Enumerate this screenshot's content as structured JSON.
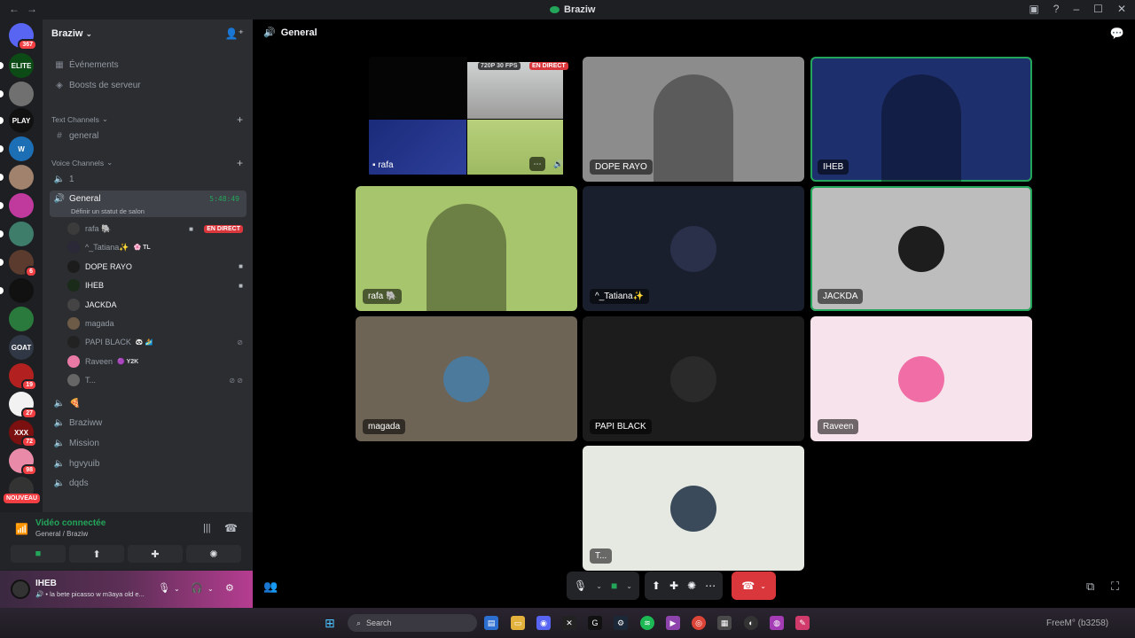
{
  "window": {
    "title": "Braziw"
  },
  "servers": [
    {
      "id": "discord-home",
      "badge": "367",
      "color": "#5865f2"
    },
    {
      "id": "elite",
      "label": "ELITE",
      "color": "#0c4a16"
    },
    {
      "id": "s3",
      "color": "#707070"
    },
    {
      "id": "s4",
      "label": "PLAY",
      "color": "#111"
    },
    {
      "id": "s5",
      "label": "W",
      "color": "#1c6fb5"
    },
    {
      "id": "s6",
      "color": "#a0826d"
    },
    {
      "id": "s7",
      "color": "#c0399d"
    },
    {
      "id": "s8",
      "color": "#3d7d6a"
    },
    {
      "id": "s9",
      "badge": "6",
      "color": "#5a3b2e"
    },
    {
      "id": "s10",
      "color": "#111"
    },
    {
      "id": "s11",
      "color": "#2a7a3d"
    },
    {
      "id": "s12",
      "label": "GOAT",
      "color": "#303845"
    },
    {
      "id": "s13",
      "badge": "19",
      "color": "#b32020"
    },
    {
      "id": "s14",
      "badge": "27",
      "color": "#f2f2f2"
    },
    {
      "id": "s15",
      "label": "XXX",
      "badge": "72",
      "color": "#7a1010"
    },
    {
      "id": "s16",
      "badge": "98",
      "color": "#e88aa8"
    },
    {
      "id": "s17",
      "color": "#333"
    }
  ],
  "server_new_badge": "NOUVEAU",
  "sidebar": {
    "guild_name": "Braziw",
    "top_links": [
      {
        "label": "Événements"
      },
      {
        "label": "Boosts de serveur"
      }
    ],
    "text_category": "Text Channels",
    "text_channels": [
      {
        "label": "general"
      }
    ],
    "voice_category": "Voice Channels",
    "voice_channel_1": "1",
    "active_channel": {
      "label": "General",
      "timer": "5:48:49",
      "status": "Définir un statut de salon"
    },
    "members": [
      {
        "name": "rafa 🐘",
        "live": "EN DIRECT",
        "av": "#3b3b3b"
      },
      {
        "name": "^_Tatiana✨",
        "tag": "🌸 TL",
        "av": "#2b2838"
      },
      {
        "name": "DOPE RAYO",
        "av": "#1c1c1c",
        "cam": true
      },
      {
        "name": "IHEB",
        "av": "#1a2b1a",
        "cam": true
      },
      {
        "name": "JACKDA",
        "av": "#444",
        "bright": true
      },
      {
        "name": "magada",
        "av": "#6d5a47"
      },
      {
        "name": "PAPI BLACK",
        "tag": "🐼 🏄",
        "av": "#222"
      },
      {
        "name": "Raveen",
        "tag": "🟣 Y2K",
        "av": "#e87aa5"
      },
      {
        "name": "T...",
        "av": "#666"
      }
    ],
    "other_voice_channels": [
      {
        "label": "🍕"
      },
      {
        "label": "Braziww"
      },
      {
        "label": "Mission"
      },
      {
        "label": "hgvyuib"
      },
      {
        "label": "dqds"
      }
    ]
  },
  "voice_panel": {
    "title": "Vidéo connectée",
    "subtitle": "General / Braziw"
  },
  "user_panel": {
    "name": "IHEB",
    "status": "🔊 • la bete picasso w m3aya old e..."
  },
  "main": {
    "channel": "General",
    "stream": {
      "quality": "720P 30 FPS",
      "live": "EN DIRECT",
      "label": "rafa"
    },
    "tiles": [
      {
        "label": "DOPE RAYO",
        "bg": "#8c8c8c",
        "speaking": false
      },
      {
        "label": "IHEB",
        "bg": "#1e2f6e",
        "speaking": true
      },
      {
        "label": "rafa 🐘",
        "bg": "#a6c56c",
        "speaking": false
      },
      {
        "label": "^_Tatiana✨",
        "bg": "#1a1f2e",
        "avatar": "#2a2f4a",
        "speaking": false
      },
      {
        "label": "JACKDA",
        "bg": "#bdbdbd",
        "avatar": "#1d1d1d",
        "speaking": true
      },
      {
        "label": "magada",
        "bg": "#6e6455",
        "avatar": "#4b7a9c",
        "speaking": false
      },
      {
        "label": "PAPI BLACK",
        "bg": "#1c1c1c",
        "avatar": "#2a2a2a",
        "speaking": false
      },
      {
        "label": "Raveen",
        "bg": "#f7e3ec",
        "avatar": "#f06ea5",
        "speaking": false
      },
      {
        "label": "T...",
        "bg": "#e6e9e2",
        "avatar": "#3a4a5a",
        "speaking": false
      }
    ]
  },
  "taskbar": {
    "search_placeholder": "Search",
    "watermark": "FreeM° (b3258)"
  }
}
